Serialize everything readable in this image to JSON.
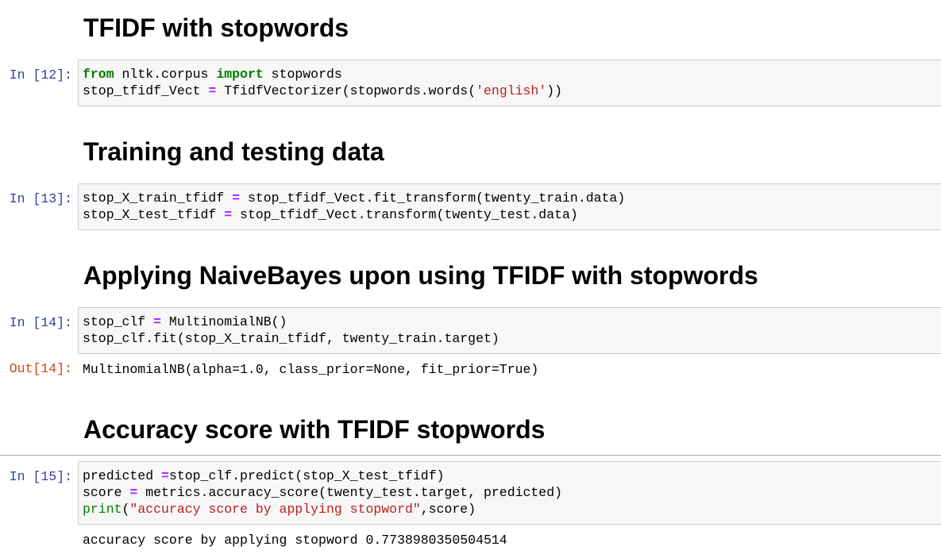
{
  "cells": [
    {
      "heading": "TFIDF with stopwords"
    },
    {
      "prompt": "In [12]:",
      "code": [
        [
          {
            "t": "from",
            "c": "kw"
          },
          {
            "t": " nltk.corpus "
          },
          {
            "t": "import",
            "c": "kw"
          },
          {
            "t": " stopwords"
          }
        ],
        [
          {
            "t": "stop_tfidf_Vect "
          },
          {
            "t": "=",
            "c": "op"
          },
          {
            "t": " TfidfVectorizer(stopwords.words("
          },
          {
            "t": "'english'",
            "c": "str"
          },
          {
            "t": "))"
          }
        ]
      ]
    },
    {
      "heading": "Training and testing data"
    },
    {
      "prompt": "In [13]:",
      "code": [
        [
          {
            "t": "stop_X_train_tfidf "
          },
          {
            "t": "=",
            "c": "op"
          },
          {
            "t": " stop_tfidf_Vect.fit_transform(twenty_train.data)"
          }
        ],
        [
          {
            "t": "stop_X_test_tfidf "
          },
          {
            "t": "=",
            "c": "op"
          },
          {
            "t": " stop_tfidf_Vect.transform(twenty_test.data)"
          }
        ]
      ]
    },
    {
      "heading": "Applying NaiveBayes upon using TFIDF with stopwords"
    },
    {
      "prompt": "In [14]:",
      "code": [
        [
          {
            "t": "stop_clf "
          },
          {
            "t": "=",
            "c": "op"
          },
          {
            "t": " MultinomialNB()"
          }
        ],
        [
          {
            "t": "stop_clf.fit(stop_X_train_tfidf, twenty_train.target)"
          }
        ]
      ]
    },
    {
      "out_prompt": "Out[14]:",
      "output": "MultinomialNB(alpha=1.0, class_prior=None, fit_prior=True)"
    },
    {
      "heading": "Accuracy score with TFIDF stopwords"
    },
    {
      "prompt": "In [15]:",
      "code": [
        [
          {
            "t": "predicted "
          },
          {
            "t": "=",
            "c": "op"
          },
          {
            "t": "stop_clf.predict(stop_X_test_tfidf)"
          }
        ],
        [
          {
            "t": "score "
          },
          {
            "t": "=",
            "c": "op"
          },
          {
            "t": " metrics.accuracy_score(twenty_test.target, predicted)"
          }
        ],
        [
          {
            "t": "print",
            "c": "bi"
          },
          {
            "t": "("
          },
          {
            "t": "\"accuracy score by applying stopword\"",
            "c": "str"
          },
          {
            "t": ",score)"
          }
        ]
      ]
    },
    {
      "output": "accuracy score by applying stopword 0.7738980350504514"
    }
  ]
}
